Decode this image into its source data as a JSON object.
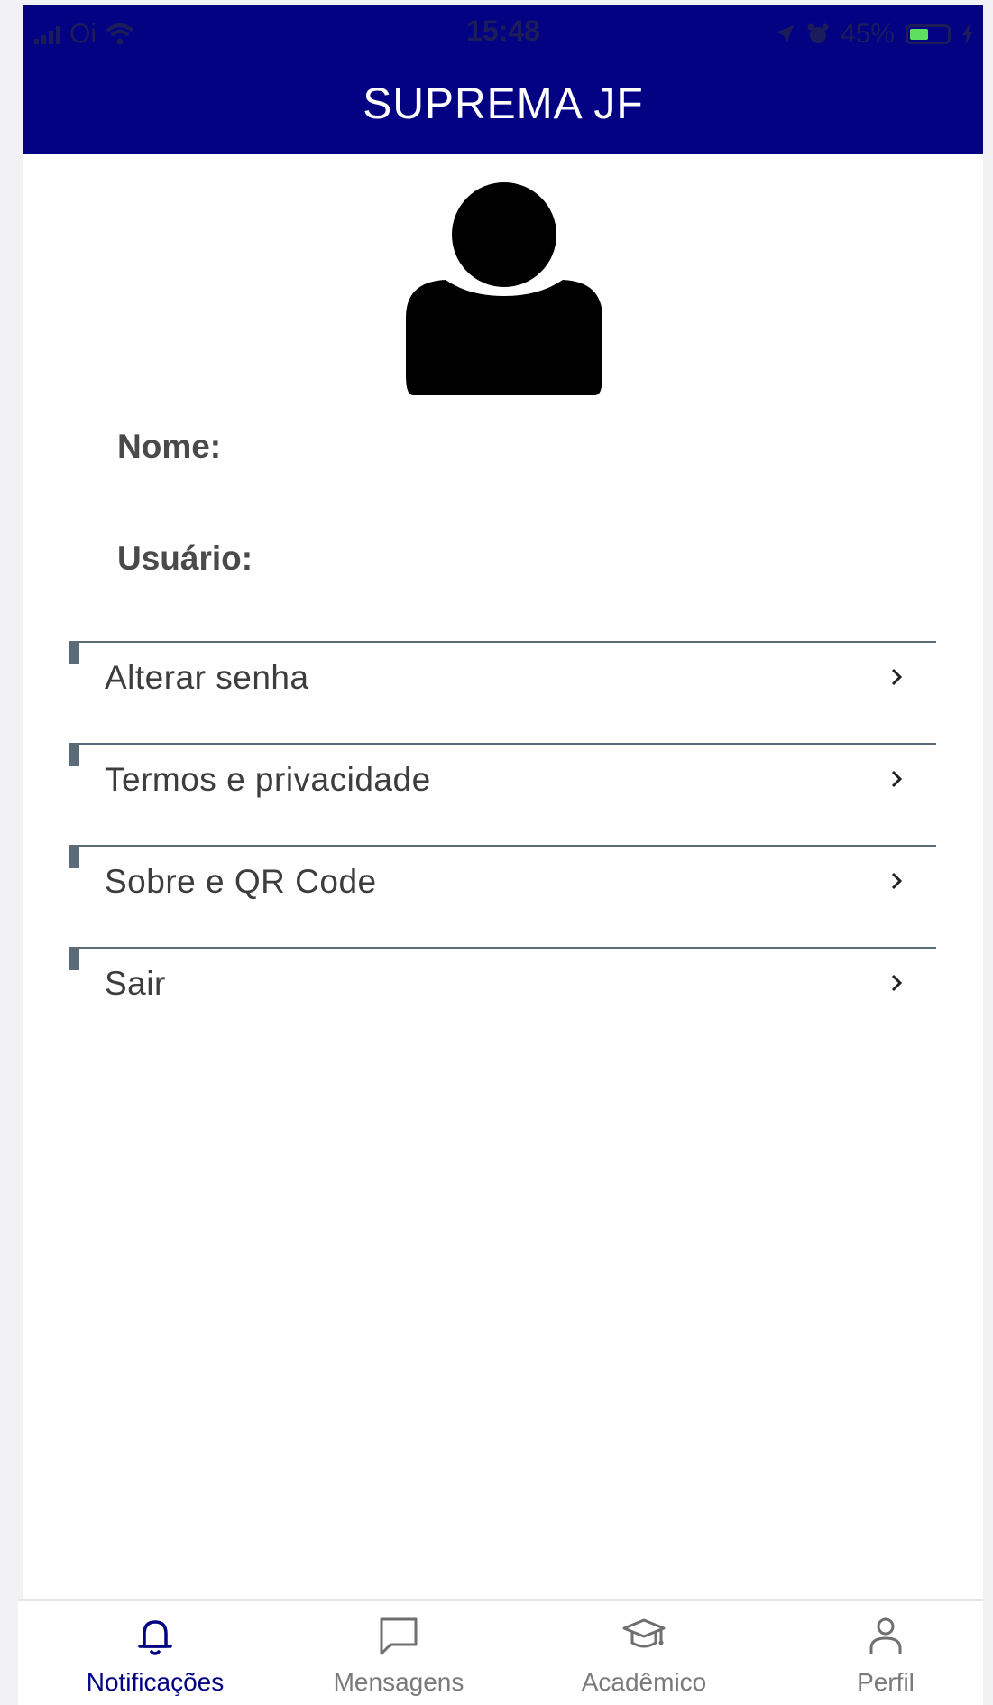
{
  "status_bar": {
    "carrier": "Oi",
    "time": "15:48",
    "battery": "45%",
    "battery_level": 0.45
  },
  "header": {
    "title": "SUPREMA JF",
    "background_color": "#020283"
  },
  "profile": {
    "name_label": "Nome:",
    "user_label": "Usuário:"
  },
  "menu": {
    "items": [
      {
        "label": "Alterar senha"
      },
      {
        "label": "Termos e privacidade"
      },
      {
        "label": "Sobre e QR Code"
      },
      {
        "label": "Sair"
      }
    ]
  },
  "tabs": [
    {
      "label": "Notificações",
      "icon": "bell-icon",
      "active": true
    },
    {
      "label": "Mensagens",
      "icon": "chat-icon",
      "active": false
    },
    {
      "label": "Acadêmico",
      "icon": "graduation-cap-icon",
      "active": false
    },
    {
      "label": "Perfil",
      "icon": "person-icon",
      "active": false
    }
  ],
  "colors": {
    "accent": "#020283",
    "menu_line": "#5b6c78"
  }
}
